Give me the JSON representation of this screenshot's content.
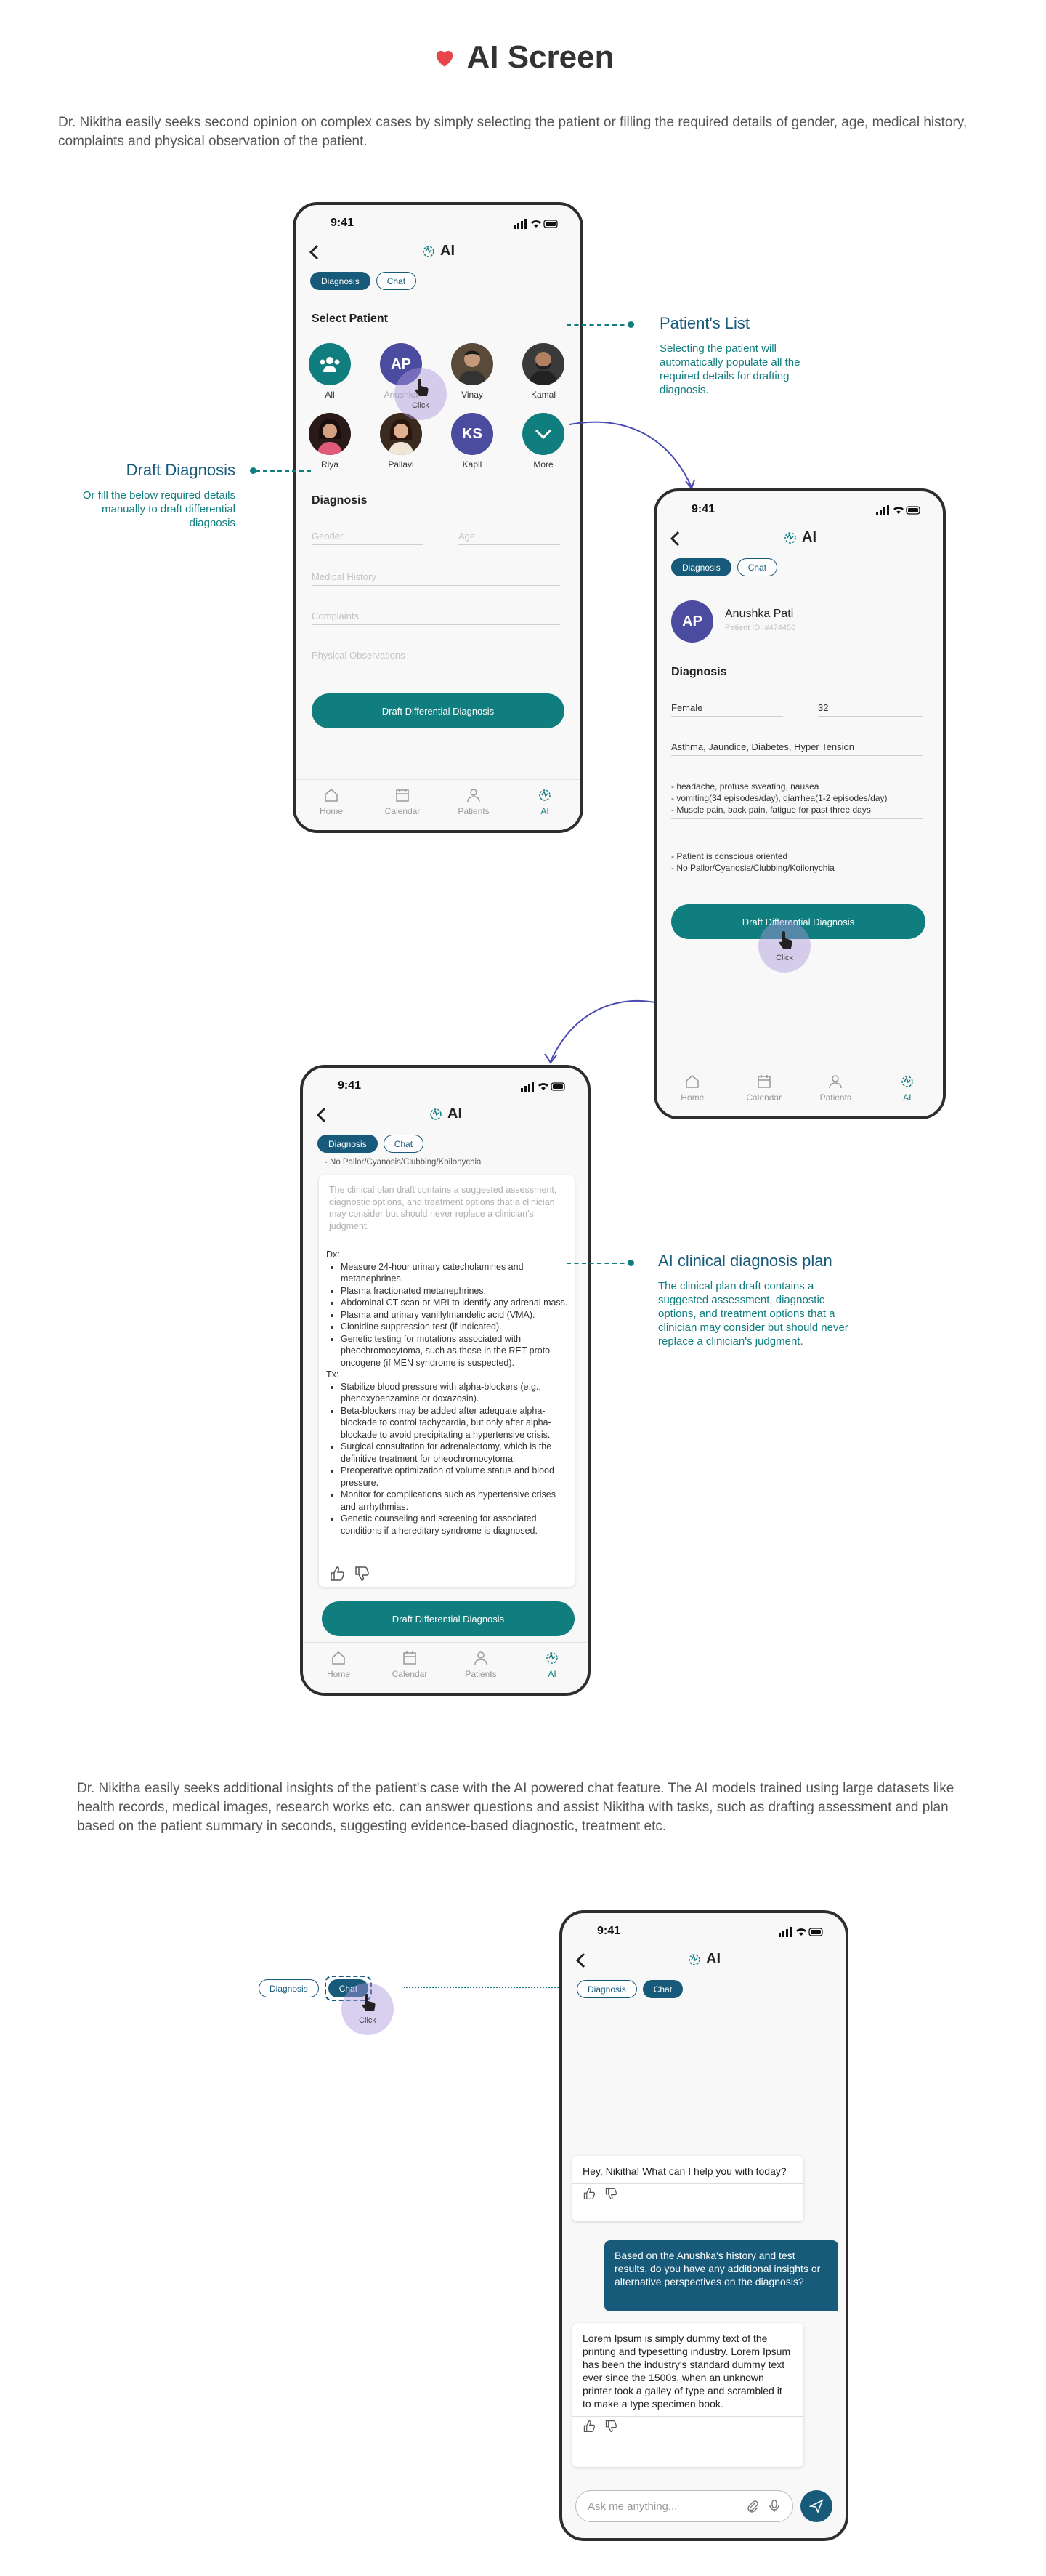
{
  "page": {
    "title": "AI Screen",
    "intro1": "Dr. Nikitha easily seeks second opinion on complex cases by simply selecting the patient or filling the required details of gender, age, medical history, complaints and physical observation of the patient.",
    "intro2": "Dr. Nikitha easily seeks additional insights of the patient's case with the AI powered chat feature. The AI models trained using large datasets like health records, medical images, research works etc. can answer questions and assist Nikitha with tasks, such as drafting assessment and plan based on the patient summary in seconds, suggesting evidence-based diagnostic, treatment etc."
  },
  "common": {
    "time": "9:41",
    "screen_title": "AI",
    "tab_diagnosis": "Diagnosis",
    "tab_chat": "Chat",
    "click": "Click",
    "nav": [
      "Home",
      "Calendar",
      "Patients",
      "AI"
    ],
    "draft_button": "Draft Differential Diagnosis",
    "accent": "#107d7e",
    "brand": "#175a7a"
  },
  "callouts": {
    "patients_title": "Patient's List",
    "patients_text": "Selecting the patient will automatically populate all the required details for drafting diagnosis.",
    "draft_title": "Draft Diagnosis",
    "draft_text": "Or fill the below required details manually to draft differential diagnosis",
    "plan_title": "AI clinical diagnosis plan",
    "plan_text": "The clinical plan draft contains a suggested assessment, diagnostic options, and treatment options that a clinician may consider but should never replace a clinician's judgment."
  },
  "screen1": {
    "select_patient": "Select Patient",
    "patients": [
      {
        "name": "All",
        "initials": ""
      },
      {
        "name": "Anushka",
        "initials": "AP"
      },
      {
        "name": "Vinay",
        "initials": ""
      },
      {
        "name": "Kamal",
        "initials": ""
      },
      {
        "name": "Riya",
        "initials": ""
      },
      {
        "name": "Pallavi",
        "initials": ""
      },
      {
        "name": "Kapil",
        "initials": "KS"
      },
      {
        "name": "More",
        "initials": ""
      }
    ],
    "diagnosis_label": "Diagnosis",
    "ph_gender": "Gender",
    "ph_age": "Age",
    "ph_history": "Medical History",
    "ph_complaints": "Complaints",
    "ph_observations": "Physical Observations"
  },
  "screen2": {
    "initials": "AP",
    "name": "Anushka Pati",
    "patient_id": "Patient ID: #474456",
    "diagnosis_label": "Diagnosis",
    "gender": "Female",
    "age": "32",
    "history": "Asthma, Jaundice, Diabetes, Hyper Tension",
    "complaints": [
      "- headache, profuse sweating, nausea",
      "- vomiting(34 episodes/day), diarrhea(1-2 episodes/day)",
      "- Muscle pain, back pain, fatigue for past three days"
    ],
    "observations": [
      "- Patient is conscious oriented",
      "- No Pallor/Cyanosis/Clubbing/Koilonychia"
    ]
  },
  "screen3": {
    "prev_line": "- No Pallor/Cyanosis/Clubbing/Koilonychia",
    "disclaimer": "The clinical plan draft contains a suggested assessment, diagnostic options, and treatment options that a clinician may consider but should never replace a clinician's judgment.",
    "dx_label": "Dx:",
    "dx": [
      "Measure 24-hour urinary catecholamines and metanephrines.",
      "Plasma fractionated metanephrines.",
      "Abdominal CT scan or MRI to identify any adrenal mass.",
      "Plasma and urinary vanillylmandelic acid (VMA).",
      "Clonidine suppression test (if indicated).",
      "Genetic testing for mutations associated with pheochromocytoma, such as those in the RET proto-oncogene (if MEN syndrome is suspected)."
    ],
    "tx_label": "Tx:",
    "tx": [
      "Stabilize blood pressure with alpha-blockers (e.g., phenoxybenzamine or doxazosin).",
      "Beta-blockers may be added after adequate alpha-blockade to control tachycardia, but only after alpha-blockade to avoid precipitating a hypertensive crisis.",
      "Surgical consultation for adrenalectomy, which is the definitive treatment for pheochromocytoma.",
      "Preoperative optimization of volume status and blood pressure.",
      "Monitor for complications such as hypertensive crises and arrhythmias.",
      "Genetic counseling and screening for associated conditions if a hereditary syndrome is diagnosed."
    ]
  },
  "screen4": {
    "ai_greeting": "Hey, Nikitha! What can I help you with today?",
    "user_msg": "Based on the Anushka's history and test results, do you have any additional insights or alternative perspectives on the diagnosis?",
    "ai_reply": "Lorem Ipsum is simply dummy text of the printing and typesetting industry. Lorem Ipsum has been the industry's standard dummy text ever since the 1500s, when an unknown printer took a galley of type and scrambled it to make a type specimen book.",
    "input_placeholder": "Ask me anything..."
  }
}
